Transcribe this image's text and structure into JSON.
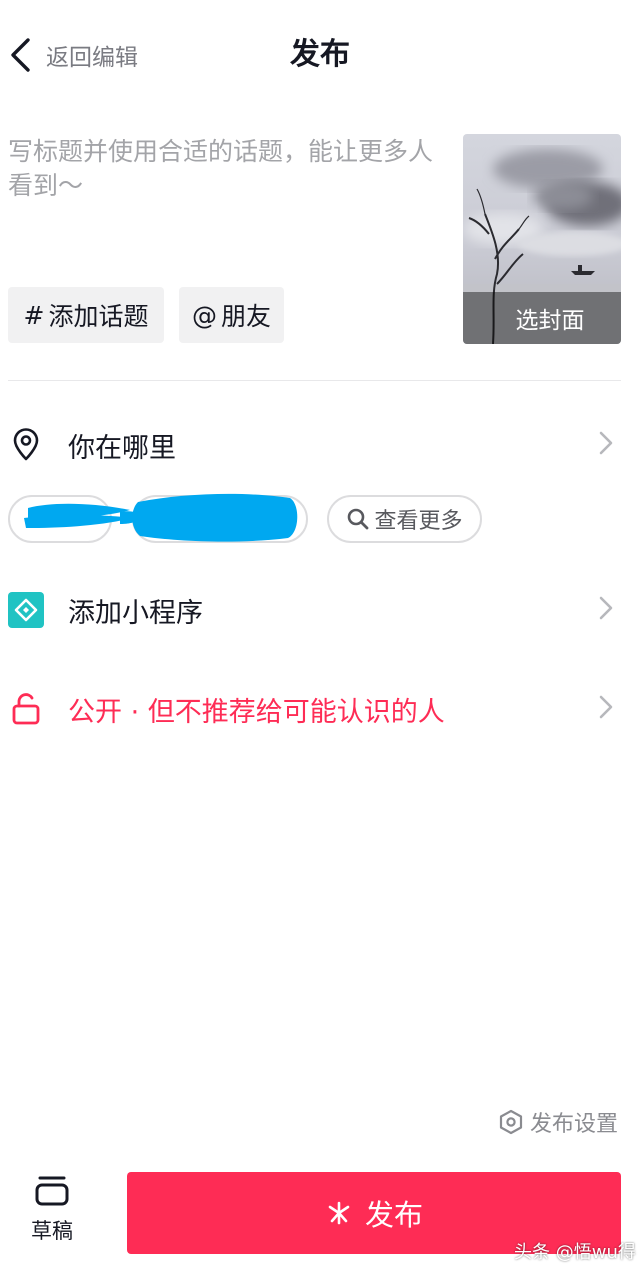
{
  "header": {
    "back_label": "返回编辑",
    "title": "发布"
  },
  "caption": {
    "placeholder": "写标题并使用合适的话题，能让更多人看到～",
    "value": ""
  },
  "chips": {
    "hashtag_symbol": "#",
    "hashtag_label": "添加话题",
    "mention_symbol": "@",
    "mention_label": "朋友"
  },
  "cover": {
    "label": "选封面"
  },
  "location": {
    "label": "你在哪里",
    "icon": "location-pin-icon",
    "more_label": "查看更多"
  },
  "mini_program": {
    "label": "添加小程序",
    "icon": "mini-program-icon"
  },
  "privacy": {
    "label": "公开 · 但不推荐给可能认识的人",
    "icon": "unlock-icon"
  },
  "publish_settings": {
    "label": "发布设置",
    "icon": "hexagon-settings-icon"
  },
  "drafts": {
    "label": "草稿",
    "icon": "drafts-box-icon"
  },
  "publish_button": {
    "label": "发布",
    "icon": "sparkle-icon"
  },
  "watermark": "头条 @悟wu得",
  "colors": {
    "accent": "#fe2c55",
    "text_primary": "#161823",
    "text_secondary": "#a3a4a8",
    "chip_background": "#f1f1f2",
    "mini_program_icon": "#20c3c3",
    "redaction": "#00a8f0"
  }
}
